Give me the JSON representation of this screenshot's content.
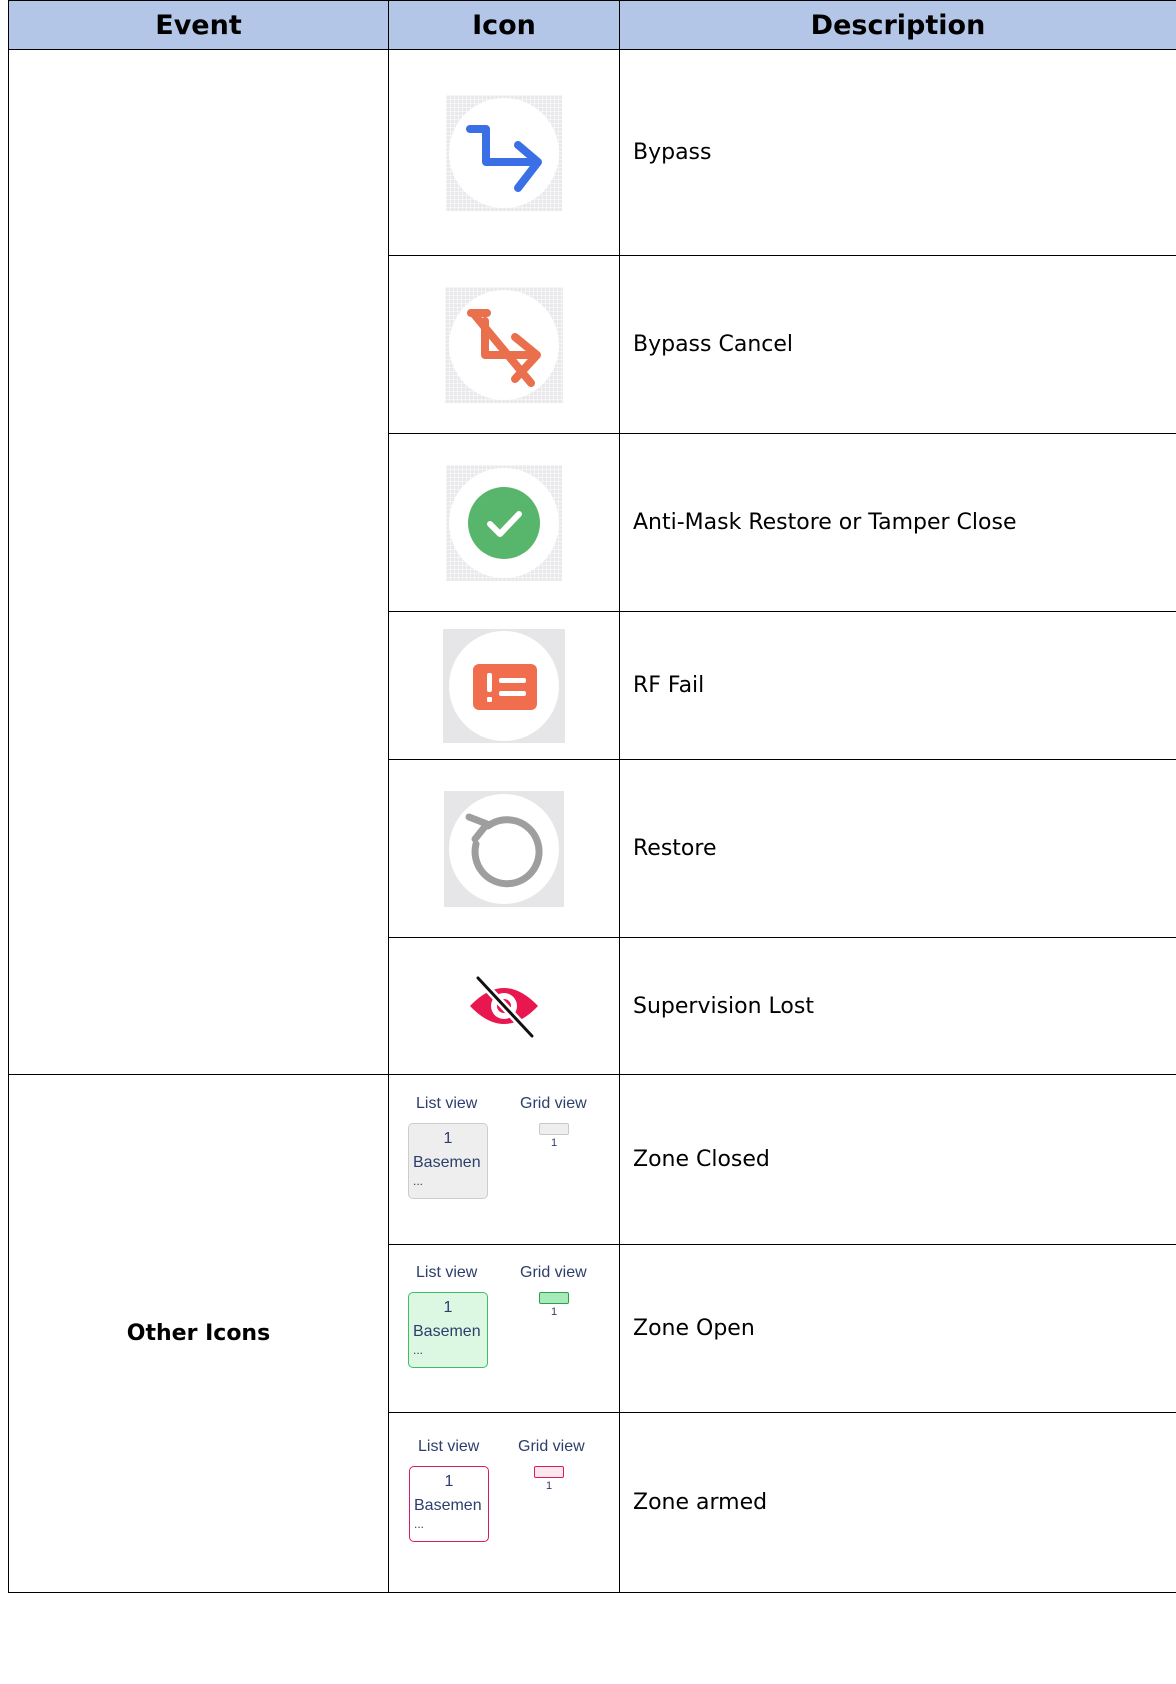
{
  "header": {
    "event": "Event",
    "icon": "Icon",
    "description": "Description"
  },
  "rows": [
    {
      "icon": "bypass-icon",
      "description": "Bypass"
    },
    {
      "icon": "bypass-cancel-icon",
      "description": "Bypass Cancel"
    },
    {
      "icon": "check-circle-icon",
      "description": "Anti-Mask Restore or Tamper Close"
    },
    {
      "icon": "rf-fail-icon",
      "description": "RF Fail"
    },
    {
      "icon": "restore-icon",
      "description": "Restore"
    },
    {
      "icon": "eye-off-icon",
      "description": "Supervision Lost"
    }
  ],
  "other_icons": {
    "event": "Other Icons",
    "rows": [
      {
        "list_label": "List view",
        "grid_label": "Grid view",
        "zone_number": "1",
        "zone_name": "Basemen",
        "ellipsis": "...",
        "description": "Zone Closed"
      },
      {
        "list_label": "List view",
        "grid_label": "Grid view",
        "zone_number": "1",
        "zone_name": "Basemen",
        "ellipsis": "...",
        "description": "Zone Open"
      },
      {
        "list_label": "List view",
        "grid_label": "Grid view",
        "zone_number": "1",
        "zone_name": "Basemen",
        "ellipsis": "...",
        "description": "Zone armed"
      }
    ]
  },
  "colors": {
    "header_bg": "#b4c6e7",
    "bypass_blue": "#3b6fe6",
    "cancel_orange": "#ea6f4c",
    "check_green": "#58b56c",
    "rf_orange": "#f06e4d",
    "restore_gray": "#9e9e9e",
    "eye_red": "#e8174f",
    "zone_open_green": "#3cbf5f",
    "zone_armed_pink": "#d81b60"
  }
}
